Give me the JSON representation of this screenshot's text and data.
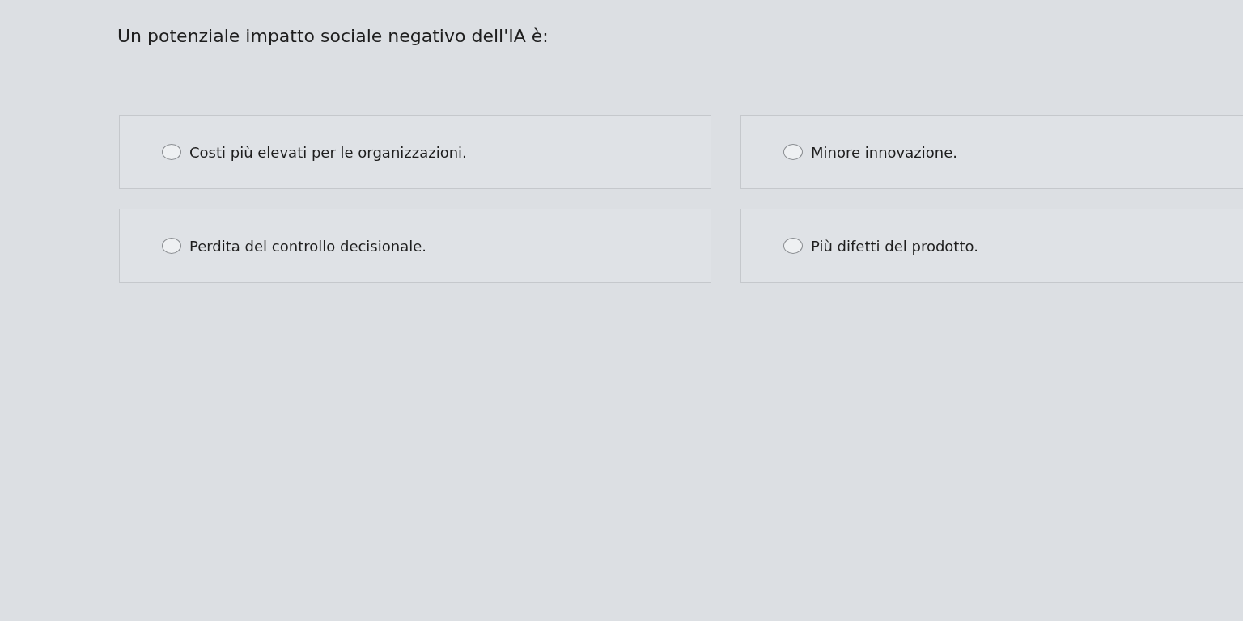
{
  "question": "Un potenziale impatto sociale negativo dell'IA è:",
  "options": [
    {
      "label": "Costi più elevati per le organizzazioni.",
      "selected": false
    },
    {
      "label": "Minore innovazione.",
      "selected": false
    },
    {
      "label": "Perdita del controllo decisionale.",
      "selected": false
    },
    {
      "label": "Più difetti del prodotto.",
      "selected": false
    }
  ]
}
